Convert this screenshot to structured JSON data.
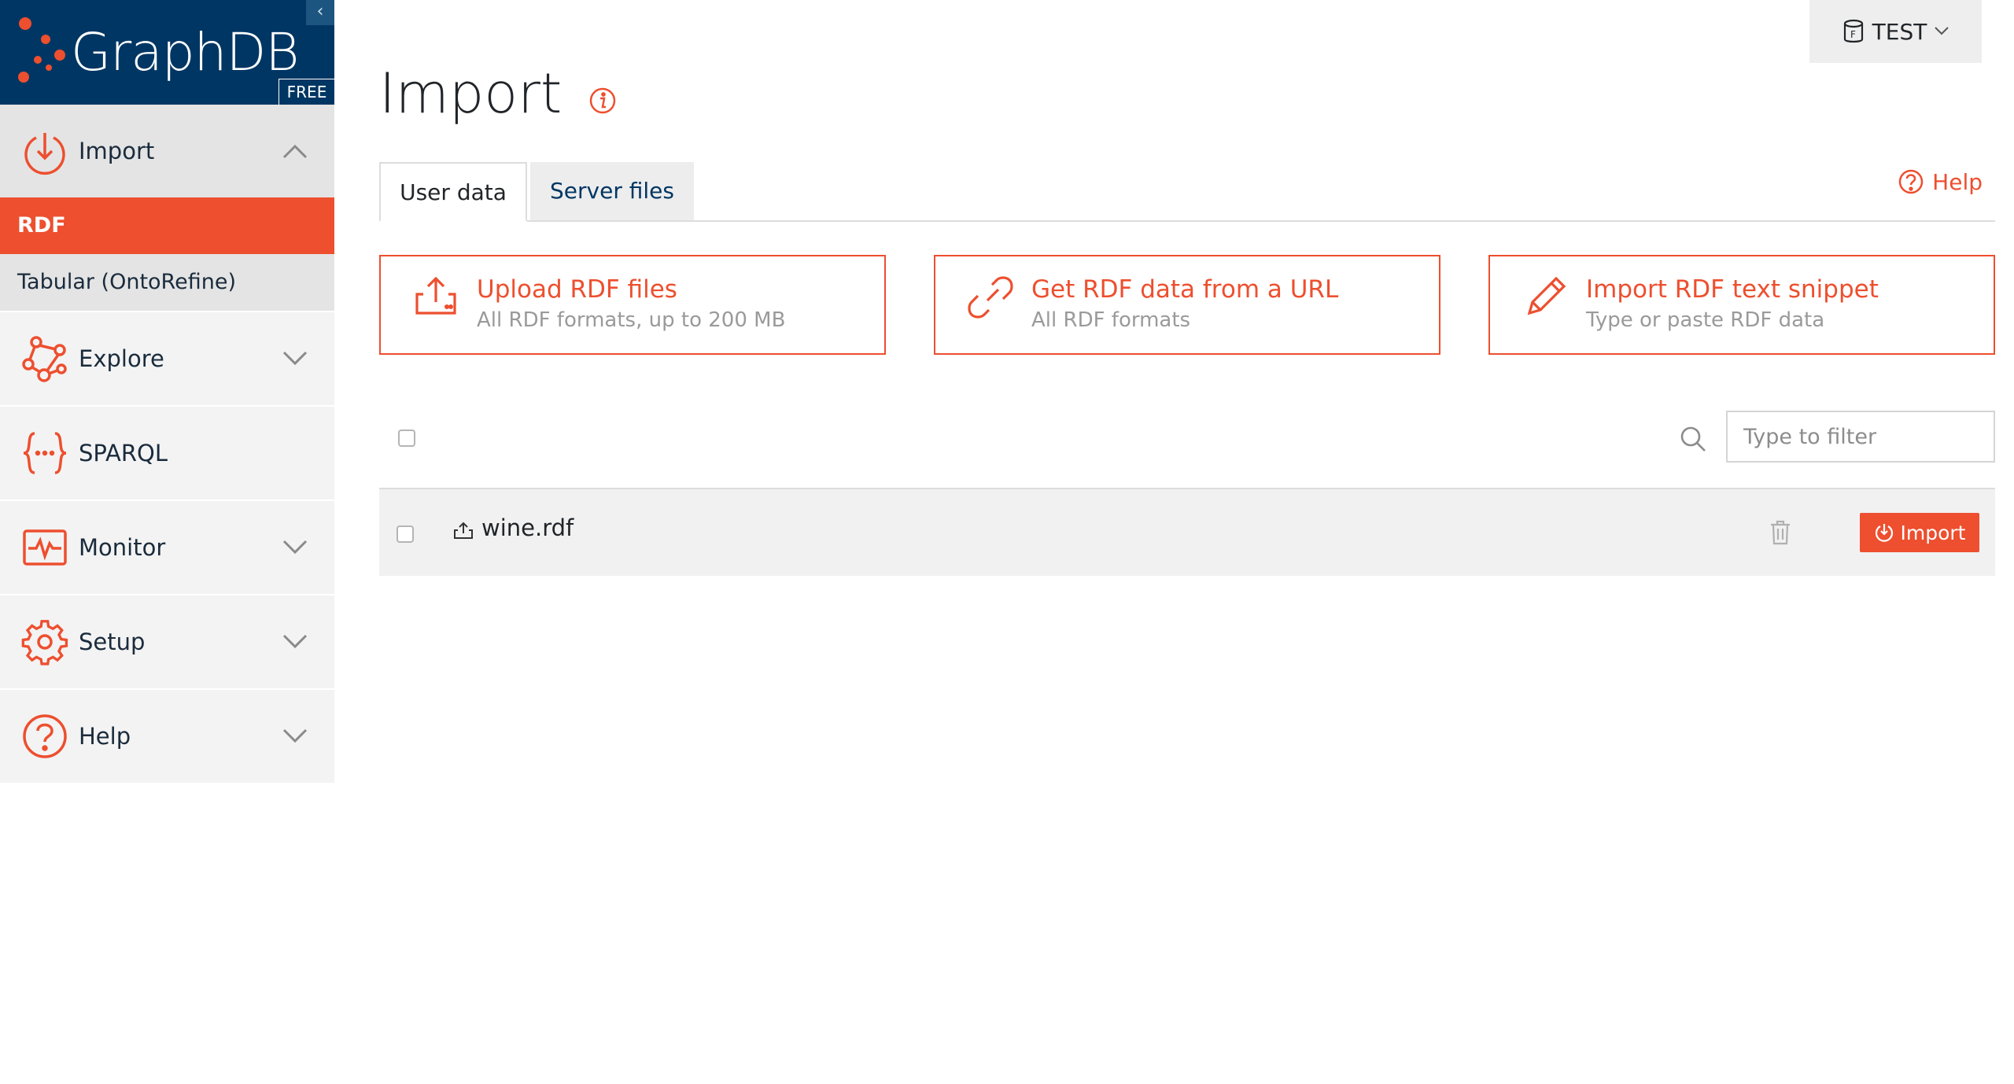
{
  "brand": {
    "name": "GraphDB",
    "edition": "FREE",
    "collapse_glyph": "‹"
  },
  "sidebar": {
    "items": [
      {
        "label": "Import",
        "icon": "import-icon",
        "expanded": true,
        "subitems": [
          {
            "label": "RDF",
            "active": true
          },
          {
            "label": "Tabular (OntoRefine)",
            "active": false
          }
        ]
      },
      {
        "label": "Explore",
        "icon": "explore-icon"
      },
      {
        "label": "SPARQL",
        "icon": "sparql-icon"
      },
      {
        "label": "Monitor",
        "icon": "monitor-icon"
      },
      {
        "label": "Setup",
        "icon": "gear-icon"
      },
      {
        "label": "Help",
        "icon": "help-icon"
      }
    ]
  },
  "repo": {
    "label": "TEST",
    "icon": "repository-icon"
  },
  "page": {
    "title": "Import"
  },
  "tabs": [
    {
      "label": "User data",
      "active": true
    },
    {
      "label": "Server files",
      "active": false
    }
  ],
  "help_link": "Help",
  "cards": [
    {
      "title": "Upload RDF files",
      "subtitle": "All RDF formats, up to 200 MB",
      "icon": "upload-icon"
    },
    {
      "title": "Get RDF data from a URL",
      "subtitle": "All RDF formats",
      "icon": "link-icon"
    },
    {
      "title": "Import RDF text snippet",
      "subtitle": "Type or paste RDF data",
      "icon": "pencil-icon"
    }
  ],
  "filter": {
    "placeholder": "Type to filter",
    "value": ""
  },
  "files": [
    {
      "name": "wine.rdf",
      "import_label": "Import"
    }
  ],
  "colors": {
    "accent": "#ed4f2f",
    "brand": "#003663"
  }
}
